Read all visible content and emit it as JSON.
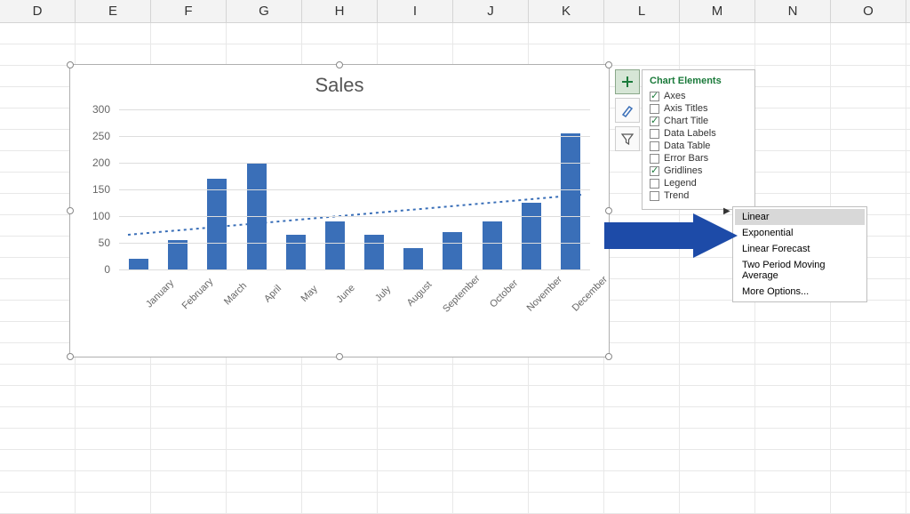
{
  "columns": [
    "D",
    "E",
    "F",
    "G",
    "H",
    "I",
    "J",
    "K",
    "L",
    "M",
    "N",
    "O"
  ],
  "chart_buttons": {
    "plus": "+",
    "brush": "/",
    "filter": "▽"
  },
  "elements_panel": {
    "title": "Chart Elements",
    "items": [
      {
        "label": "Axes",
        "checked": true
      },
      {
        "label": "Axis Titles",
        "checked": false
      },
      {
        "label": "Chart Title",
        "checked": true
      },
      {
        "label": "Data Labels",
        "checked": false
      },
      {
        "label": "Data Table",
        "checked": false
      },
      {
        "label": "Error Bars",
        "checked": false
      },
      {
        "label": "Gridlines",
        "checked": true
      },
      {
        "label": "Legend",
        "checked": false
      },
      {
        "label": "Trend",
        "checked": false
      }
    ]
  },
  "trendline_menu": {
    "items": [
      {
        "label": "Linear",
        "hover": true
      },
      {
        "label": "Exponential",
        "hover": false
      },
      {
        "label": "Linear Forecast",
        "hover": false
      },
      {
        "label": "Two Period Moving Average",
        "hover": false
      },
      {
        "label": "More Options...",
        "hover": false
      }
    ]
  },
  "chart_data": {
    "type": "bar",
    "title": "Sales",
    "categories": [
      "January",
      "February",
      "March",
      "April",
      "May",
      "June",
      "July",
      "August",
      "September",
      "October",
      "November",
      "December"
    ],
    "values": [
      20,
      55,
      170,
      200,
      65,
      90,
      65,
      40,
      70,
      90,
      125,
      255
    ],
    "ylim": [
      0,
      300
    ],
    "yticks": [
      0,
      50,
      100,
      150,
      200,
      250,
      300
    ],
    "xlabel": "",
    "ylabel": "",
    "trendline": {
      "type": "linear",
      "start": 65,
      "end": 140
    }
  }
}
